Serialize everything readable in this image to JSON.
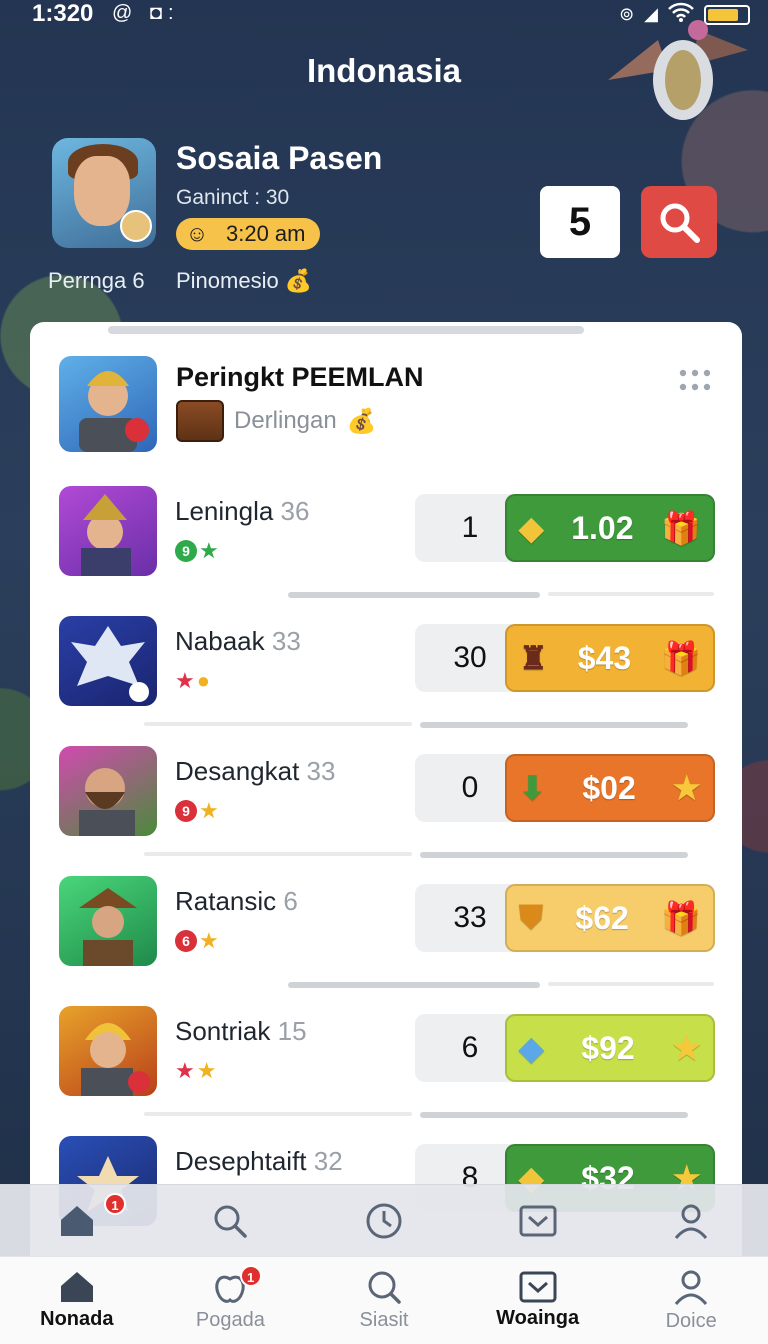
{
  "status_bar": {
    "time": "1:320",
    "left_icons": "@ ◘:"
  },
  "header": {
    "country": "Indonasia"
  },
  "profile": {
    "name": "Sosaia Pasen",
    "subtitle": "Ganinct : 30",
    "time": "3:20 am",
    "stat_left": "Perrnga 6",
    "stat_right": "Pinomesio",
    "count": "5"
  },
  "leaderboard": {
    "title": "Peringkt PEEMLAN",
    "subtitle": "Derlingan",
    "rows": [
      {
        "name": "Leningla",
        "level": "36",
        "badge_num": "9",
        "badge_color": "#2eaa4a",
        "badge2": "★",
        "badge2_color": "#2eaa4a",
        "rank": "1",
        "reward": "1.02",
        "reward_color": "#3f9a3c",
        "left_icon": "◆",
        "right_icon": "🎁"
      },
      {
        "name": "Nabaak",
        "level": "33",
        "badge_num": "",
        "badge_color": "",
        "badge2": "★",
        "badge2_color": "#e0304a",
        "rank": "30",
        "reward": "$43",
        "reward_color": "#f2b233",
        "left_icon": "♜",
        "right_icon": "🎁"
      },
      {
        "name": "Desangkat",
        "level": "33",
        "badge_num": "9",
        "badge_color": "#d9303a",
        "badge2": "★",
        "badge2_color": "#f0b21e",
        "rank": "0",
        "reward": "$02",
        "reward_color": "#e8752a",
        "left_icon": "⬇",
        "right_icon": "★"
      },
      {
        "name": "Ratansic",
        "level": "6",
        "badge_num": "6",
        "badge_color": "#d9303a",
        "badge2": "★",
        "badge2_color": "#f0b21e",
        "rank": "33",
        "reward": "$62",
        "reward_color": "#f6cd6a",
        "left_icon": "⛊",
        "right_icon": "🎁"
      },
      {
        "name": "Sontriak",
        "level": "15",
        "badge_num": "",
        "badge_color": "",
        "badge2": "★★",
        "badge2_color": "#e0304a",
        "rank": "6",
        "reward": "$92",
        "reward_color": "#c7e04a",
        "left_icon": "◆",
        "right_icon": "★"
      },
      {
        "name": "Desephtaift",
        "level": "32",
        "badge_num": "",
        "badge_color": "",
        "badge2": "",
        "badge2_color": "",
        "rank": "8",
        "reward": "$32",
        "reward_color": "#3f9a3c",
        "left_icon": "◆",
        "right_icon": "★"
      }
    ]
  },
  "bottom_nav": {
    "badge_home": "1",
    "badge_pogada": "1",
    "tabs": [
      {
        "label": "Nonada",
        "icon": "home-icon",
        "active": true
      },
      {
        "label": "Pogada",
        "icon": "apple-icon",
        "active": false
      },
      {
        "label": "Siasit",
        "icon": "search-icon",
        "active": false
      },
      {
        "label": "Woainga",
        "icon": "mail-icon",
        "active": true
      },
      {
        "label": "Doice",
        "icon": "user-icon",
        "active": false
      }
    ]
  }
}
